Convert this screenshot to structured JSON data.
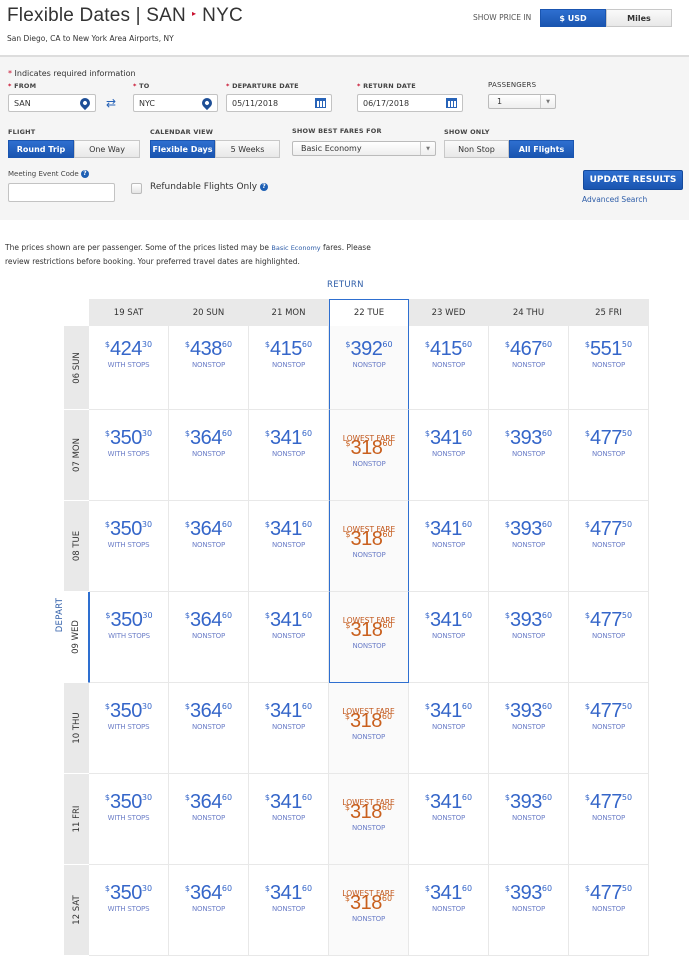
{
  "header": {
    "title_prefix": "Flexible Dates | SAN",
    "title_suffix": "NYC",
    "arrow": "▸",
    "subtitle": "San Diego, CA to New York Area Airports, NY",
    "show_price_label": "SHOW PRICE IN",
    "price_options": [
      {
        "label": "$ USD",
        "active": true
      },
      {
        "label": "Miles",
        "active": false
      }
    ]
  },
  "form": {
    "required_note": "Indicates required information",
    "from": {
      "label": "FROM",
      "value": "SAN",
      "icon": "map-pin-icon"
    },
    "swap_icon": "⇄",
    "to": {
      "label": "TO",
      "value": "NYC",
      "icon": "map-pin-icon"
    },
    "departure": {
      "label": "DEPARTURE DATE",
      "value": "05/11/2018",
      "icon": "calendar-icon"
    },
    "return": {
      "label": "RETURN DATE",
      "value": "06/17/2018",
      "icon": "calendar-icon"
    },
    "passengers": {
      "label": "PASSENGERS",
      "value": "1"
    },
    "flight": {
      "label": "FLIGHT",
      "options": [
        {
          "label": "Round Trip",
          "active": true
        },
        {
          "label": "One Way",
          "active": false
        }
      ]
    },
    "calendar_view": {
      "label": "CALENDAR VIEW",
      "options": [
        {
          "label": "Flexible Days",
          "active": true
        },
        {
          "label": "5 Weeks",
          "active": false
        }
      ]
    },
    "best_fares": {
      "label": "SHOW BEST FARES FOR",
      "value": "Basic Economy"
    },
    "show_only": {
      "label": "SHOW ONLY",
      "options": [
        {
          "label": "Non Stop",
          "active": false
        },
        {
          "label": "All Flights",
          "active": true
        }
      ]
    },
    "meeting_code": {
      "label": "Meeting Event Code",
      "value": "",
      "placeholder": ""
    },
    "refundable": {
      "label": "Refundable Flights Only",
      "checked": false
    },
    "info_icon": "?",
    "update_button": "UPDATE RESULTS",
    "advanced_search": "Advanced Search"
  },
  "notice": {
    "text_before": "The prices shown are per passenger. Some of the prices listed may be ",
    "link": "Basic Economy",
    "text_after": " fares. Please review restrictions before booking. Your preferred travel dates are highlighted."
  },
  "calendar": {
    "return_label": "RETURN",
    "depart_label": "DEPART",
    "lowest_fare_label": "LOWEST FARE",
    "currency_symbol": "$",
    "selected_return_index": 3,
    "selected_depart_index": 3,
    "return_dates": [
      "19 SAT",
      "20 SUN",
      "21 MON",
      "22 TUE",
      "23 WED",
      "24 THU",
      "25 FRI"
    ],
    "rows": [
      {
        "depart": "06 SUN",
        "fares": [
          {
            "whole": "424",
            "cents": "30",
            "stops": "WITH STOPS",
            "lowest": false
          },
          {
            "whole": "438",
            "cents": "60",
            "stops": "NONSTOP",
            "lowest": false
          },
          {
            "whole": "415",
            "cents": "60",
            "stops": "NONSTOP",
            "lowest": false
          },
          {
            "whole": "392",
            "cents": "60",
            "stops": "NONSTOP",
            "lowest": false
          },
          {
            "whole": "415",
            "cents": "60",
            "stops": "NONSTOP",
            "lowest": false
          },
          {
            "whole": "467",
            "cents": "60",
            "stops": "NONSTOP",
            "lowest": false
          },
          {
            "whole": "551",
            "cents": "50",
            "stops": "NONSTOP",
            "lowest": false
          }
        ]
      },
      {
        "depart": "07 MON",
        "fares": [
          {
            "whole": "350",
            "cents": "30",
            "stops": "WITH STOPS",
            "lowest": false
          },
          {
            "whole": "364",
            "cents": "60",
            "stops": "NONSTOP",
            "lowest": false
          },
          {
            "whole": "341",
            "cents": "60",
            "stops": "NONSTOP",
            "lowest": false
          },
          {
            "whole": "318",
            "cents": "60",
            "stops": "NONSTOP",
            "lowest": true
          },
          {
            "whole": "341",
            "cents": "60",
            "stops": "NONSTOP",
            "lowest": false
          },
          {
            "whole": "393",
            "cents": "60",
            "stops": "NONSTOP",
            "lowest": false
          },
          {
            "whole": "477",
            "cents": "50",
            "stops": "NONSTOP",
            "lowest": false
          }
        ]
      },
      {
        "depart": "08 TUE",
        "fares": [
          {
            "whole": "350",
            "cents": "30",
            "stops": "WITH STOPS",
            "lowest": false
          },
          {
            "whole": "364",
            "cents": "60",
            "stops": "NONSTOP",
            "lowest": false
          },
          {
            "whole": "341",
            "cents": "60",
            "stops": "NONSTOP",
            "lowest": false
          },
          {
            "whole": "318",
            "cents": "60",
            "stops": "NONSTOP",
            "lowest": true
          },
          {
            "whole": "341",
            "cents": "60",
            "stops": "NONSTOP",
            "lowest": false
          },
          {
            "whole": "393",
            "cents": "60",
            "stops": "NONSTOP",
            "lowest": false
          },
          {
            "whole": "477",
            "cents": "50",
            "stops": "NONSTOP",
            "lowest": false
          }
        ]
      },
      {
        "depart": "09 WED",
        "fares": [
          {
            "whole": "350",
            "cents": "30",
            "stops": "WITH STOPS",
            "lowest": false
          },
          {
            "whole": "364",
            "cents": "60",
            "stops": "NONSTOP",
            "lowest": false
          },
          {
            "whole": "341",
            "cents": "60",
            "stops": "NONSTOP",
            "lowest": false
          },
          {
            "whole": "318",
            "cents": "60",
            "stops": "NONSTOP",
            "lowest": true
          },
          {
            "whole": "341",
            "cents": "60",
            "stops": "NONSTOP",
            "lowest": false
          },
          {
            "whole": "393",
            "cents": "60",
            "stops": "NONSTOP",
            "lowest": false
          },
          {
            "whole": "477",
            "cents": "50",
            "stops": "NONSTOP",
            "lowest": false
          }
        ]
      },
      {
        "depart": "10 THU",
        "fares": [
          {
            "whole": "350",
            "cents": "30",
            "stops": "WITH STOPS",
            "lowest": false
          },
          {
            "whole": "364",
            "cents": "60",
            "stops": "NONSTOP",
            "lowest": false
          },
          {
            "whole": "341",
            "cents": "60",
            "stops": "NONSTOP",
            "lowest": false
          },
          {
            "whole": "318",
            "cents": "60",
            "stops": "NONSTOP",
            "lowest": true
          },
          {
            "whole": "341",
            "cents": "60",
            "stops": "NONSTOP",
            "lowest": false
          },
          {
            "whole": "393",
            "cents": "60",
            "stops": "NONSTOP",
            "lowest": false
          },
          {
            "whole": "477",
            "cents": "50",
            "stops": "NONSTOP",
            "lowest": false
          }
        ]
      },
      {
        "depart": "11 FRI",
        "fares": [
          {
            "whole": "350",
            "cents": "30",
            "stops": "WITH STOPS",
            "lowest": false
          },
          {
            "whole": "364",
            "cents": "60",
            "stops": "NONSTOP",
            "lowest": false
          },
          {
            "whole": "341",
            "cents": "60",
            "stops": "NONSTOP",
            "lowest": false
          },
          {
            "whole": "318",
            "cents": "60",
            "stops": "NONSTOP",
            "lowest": true
          },
          {
            "whole": "341",
            "cents": "60",
            "stops": "NONSTOP",
            "lowest": false
          },
          {
            "whole": "393",
            "cents": "60",
            "stops": "NONSTOP",
            "lowest": false
          },
          {
            "whole": "477",
            "cents": "50",
            "stops": "NONSTOP",
            "lowest": false
          }
        ]
      },
      {
        "depart": "12 SAT",
        "fares": [
          {
            "whole": "350",
            "cents": "30",
            "stops": "WITH STOPS",
            "lowest": false
          },
          {
            "whole": "364",
            "cents": "60",
            "stops": "NONSTOP",
            "lowest": false
          },
          {
            "whole": "341",
            "cents": "60",
            "stops": "NONSTOP",
            "lowest": false
          },
          {
            "whole": "318",
            "cents": "60",
            "stops": "NONSTOP",
            "lowest": true
          },
          {
            "whole": "341",
            "cents": "60",
            "stops": "NONSTOP",
            "lowest": false
          },
          {
            "whole": "393",
            "cents": "60",
            "stops": "NONSTOP",
            "lowest": false
          },
          {
            "whole": "477",
            "cents": "50",
            "stops": "NONSTOP",
            "lowest": false
          }
        ]
      }
    ]
  },
  "colors": {
    "brand_blue": "#1a55b0",
    "price_blue": "#3566c9",
    "lowest_orange": "#c9601e",
    "required_red": "#c8102e"
  }
}
